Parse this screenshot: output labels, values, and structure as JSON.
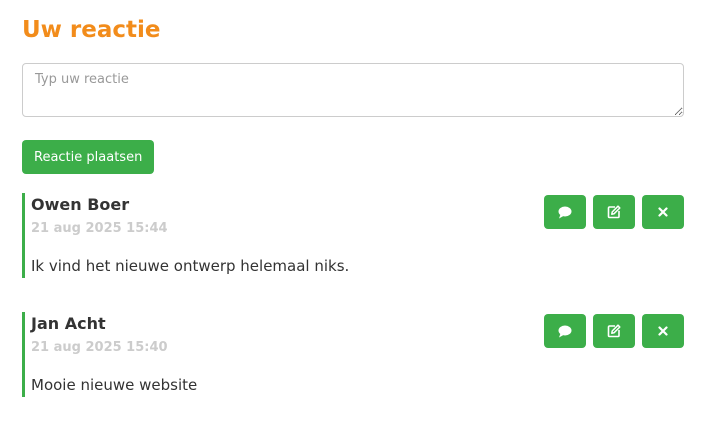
{
  "section": {
    "title": "Uw reactie"
  },
  "form": {
    "placeholder": "Typ uw reactie",
    "value": "",
    "submit_label": "Reactie plaatsen"
  },
  "colors": {
    "accent_orange": "#f28c1b",
    "button_green": "#3cae49",
    "date_gray": "#cccccc"
  },
  "comments": [
    {
      "author": "Owen Boer",
      "date": "21 aug 2025 15:44",
      "text": "Ik vind het nieuwe ontwerp helemaal niks.",
      "actions": [
        "comment-icon",
        "edit-icon",
        "close-icon"
      ]
    },
    {
      "author": "Jan Acht",
      "date": "21 aug 2025 15:40",
      "text": "Mooie nieuwe website",
      "actions": [
        "comment-icon",
        "edit-icon",
        "close-icon"
      ]
    }
  ]
}
